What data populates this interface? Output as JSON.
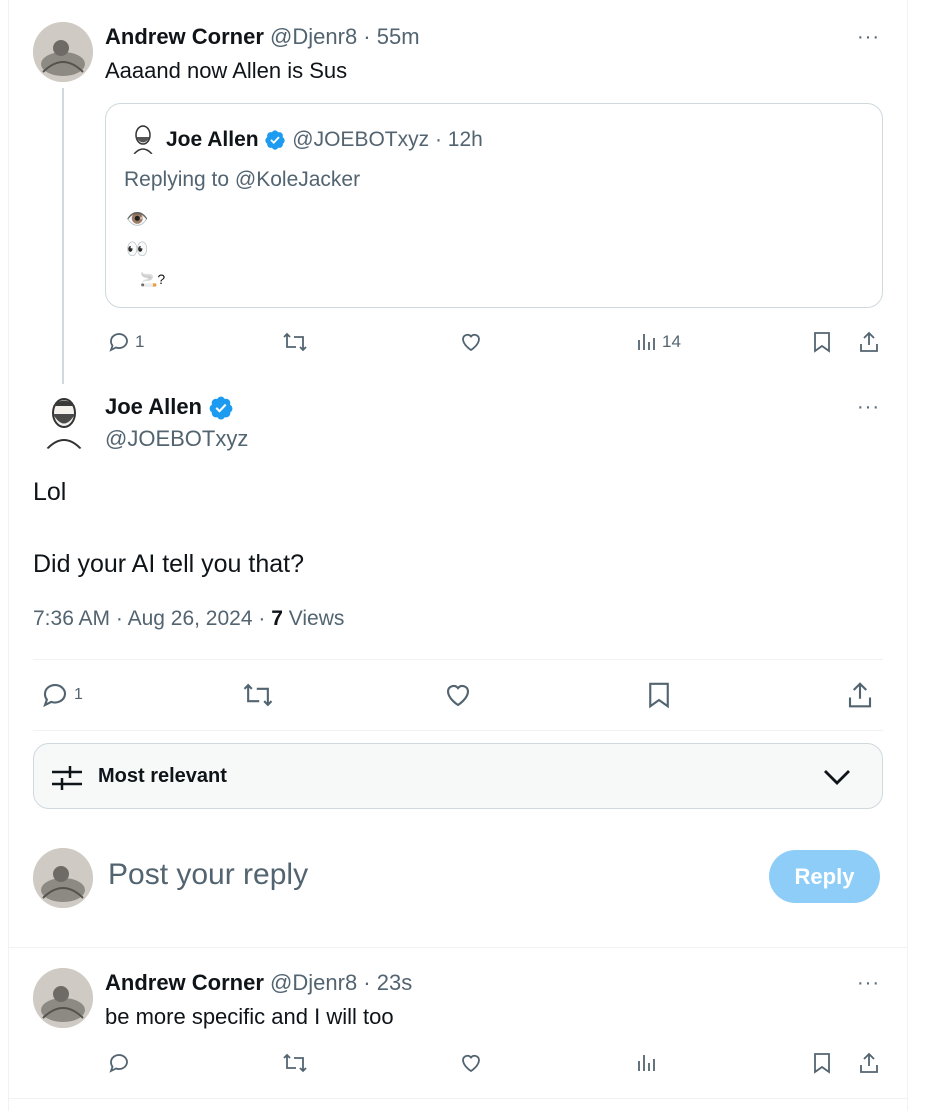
{
  "tweet1": {
    "name": "Andrew Corner",
    "handle": "@Djenr8",
    "time": "55m",
    "text": "Aaaand now Allen is Sus",
    "reply_count": "1",
    "views": "14",
    "quote": {
      "name": "Joe Allen",
      "handle": "@JOEBOTxyz",
      "time": "12h",
      "replying_to": "Replying to @KoleJacker",
      "line1": "👁️",
      "line2": "👀",
      "line3": "🚬?"
    }
  },
  "main": {
    "name": "Joe Allen",
    "handle": "@JOEBOTxyz",
    "text1": "Lol",
    "text2": "Did your AI tell you that?",
    "time": "7:36 AM",
    "date": "Aug 26, 2024",
    "views_count": "7",
    "views_label": "Views",
    "reply_count": "1"
  },
  "sort": {
    "label": "Most relevant"
  },
  "composer": {
    "placeholder": "Post your reply",
    "button": "Reply"
  },
  "tweet2": {
    "name": "Andrew Corner",
    "handle": "@Djenr8",
    "time": "23s",
    "text": "be more specific and I will too"
  },
  "colors": {
    "verified": "#1d9bf0",
    "muted": "#536471",
    "reply_button": "#8ecdf8"
  }
}
